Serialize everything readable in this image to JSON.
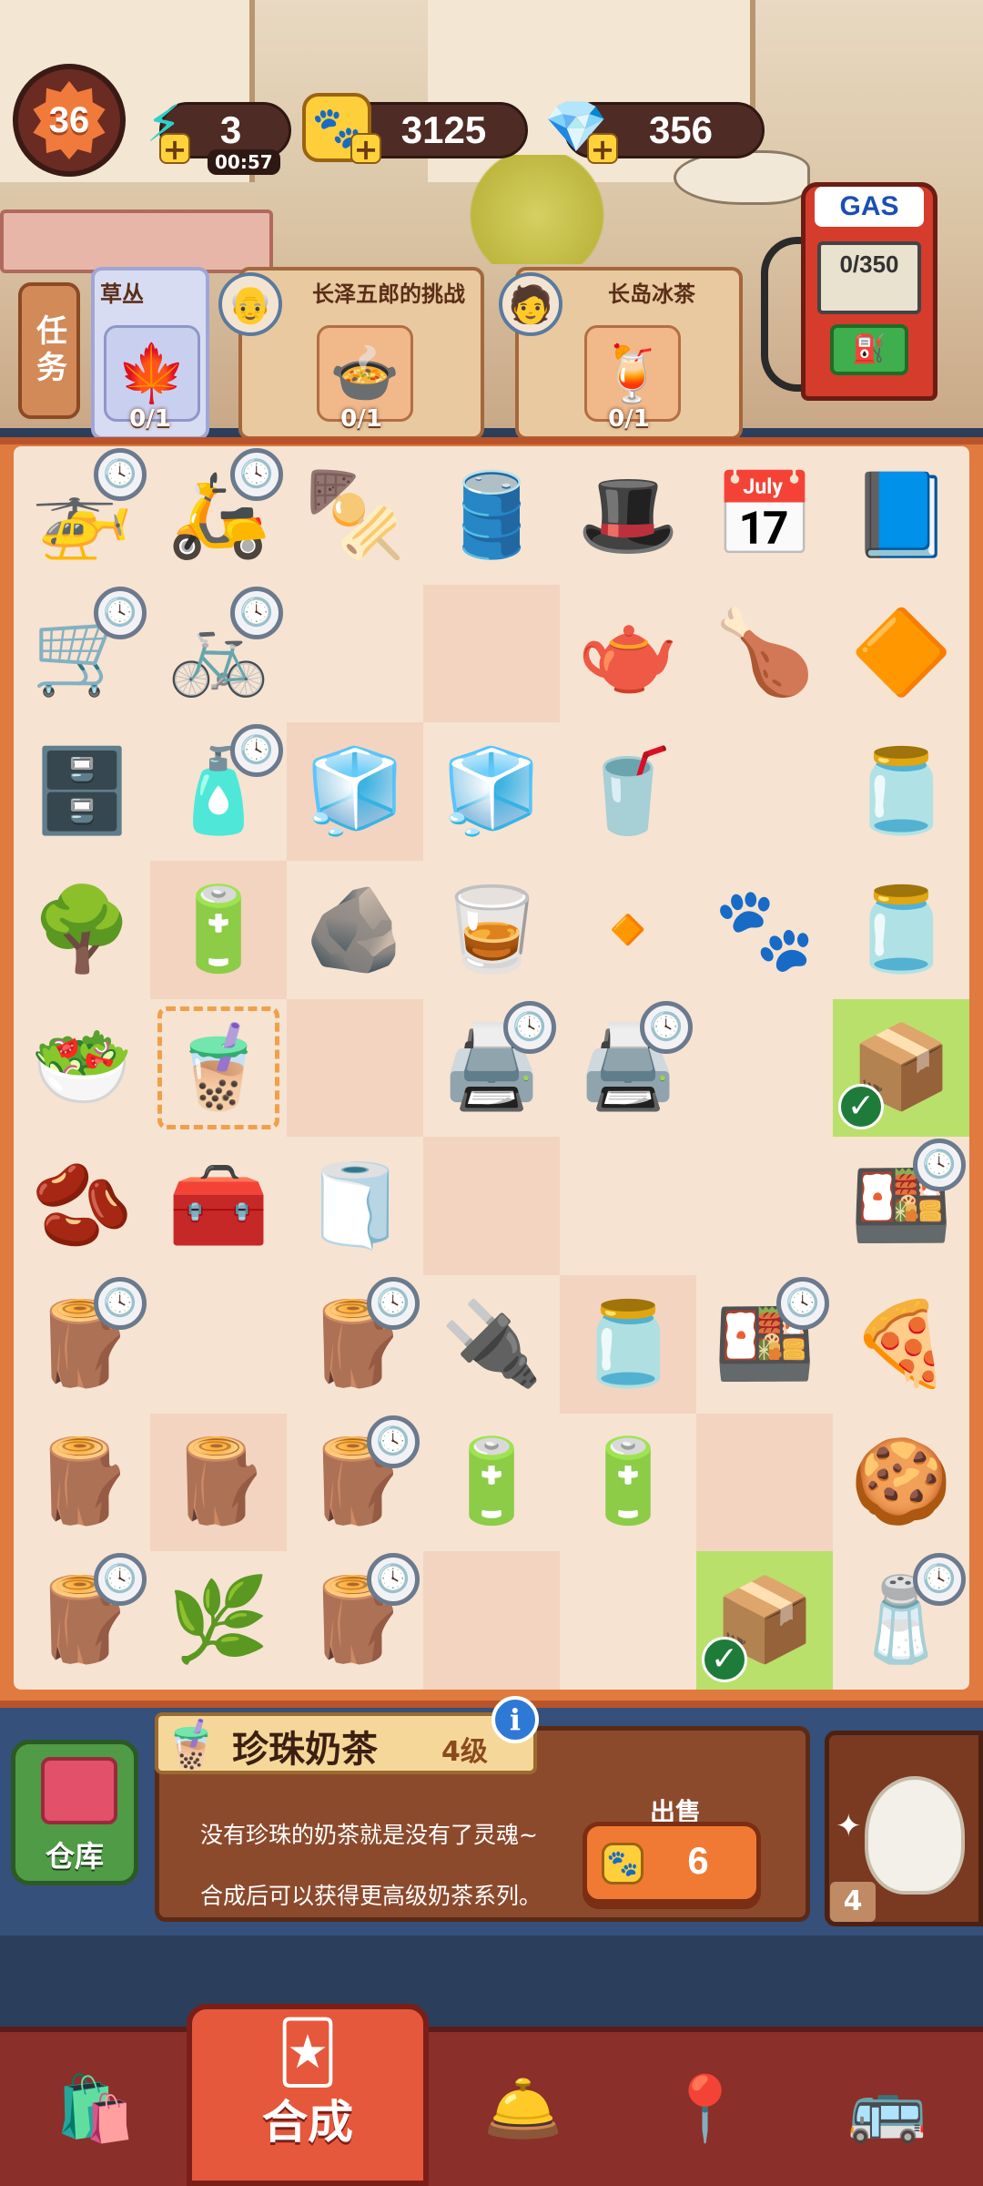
{
  "status": {
    "level": "36",
    "energy": "3",
    "energy_timer": "00:57",
    "coins": "3125",
    "gems": "356"
  },
  "gas": {
    "label": "GAS",
    "progress": "0/350"
  },
  "tasks": {
    "tab_label": "任务",
    "items": [
      {
        "title": "草丛",
        "count": "0/1"
      },
      {
        "title": "长泽五郎的挑战",
        "count": "0/1"
      },
      {
        "title": "长岛冰茶",
        "count": "0/1"
      }
    ]
  },
  "board": {
    "rows": [
      [
        "🚁",
        "🛵",
        "🍢",
        "🛢️",
        "🎩",
        "📅",
        "📘"
      ],
      [
        "🛒",
        "🚲",
        "",
        "",
        "🫖",
        "🍗",
        "🔶"
      ],
      [
        "🗄️",
        "🧴",
        "🧊",
        "🧊",
        "🥤",
        "",
        "🫙"
      ],
      [
        "🌳",
        "🔋",
        "🪨",
        "🥃",
        "🔸",
        "🐾",
        "🫙"
      ],
      [
        "🥗",
        "🧋",
        "",
        "🖨️",
        "🖨️",
        "",
        "📦"
      ],
      [
        "🫘",
        "🧰",
        "🧻",
        "",
        "",
        "",
        "🍱"
      ],
      [
        "🪵",
        "",
        "🪵",
        "🔌",
        "🫙",
        "🍱",
        "🍕"
      ],
      [
        "🪵",
        "🪵",
        "🪵",
        "🔋",
        "🔋",
        "",
        "🍪"
      ],
      [
        "🪵",
        "🌿",
        "🪵",
        "",
        "",
        "📦",
        "🧂"
      ]
    ]
  },
  "info": {
    "item_name": "珍珠奶茶",
    "item_level": "4级",
    "description_1": "没有珍珠的奶茶就是没有了灵魂~",
    "description_2": "合成后可以获得更高级奶茶系列。",
    "sell_label": "出售",
    "sell_price": "6",
    "info_button": "i"
  },
  "warehouse": {
    "label": "仓库"
  },
  "cat_box": {
    "count": "4"
  },
  "nav": {
    "active_label": "合成"
  }
}
